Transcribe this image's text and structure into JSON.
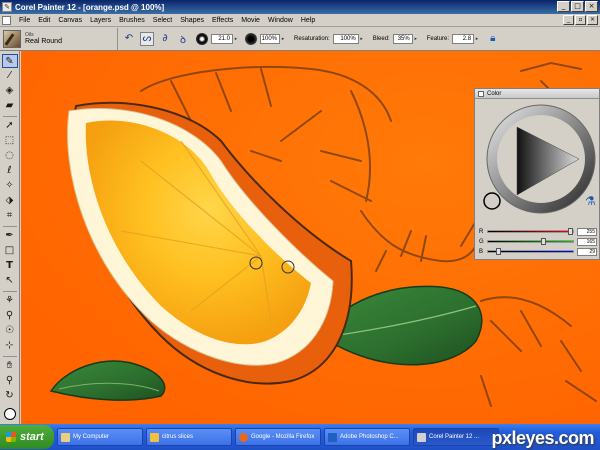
{
  "window": {
    "title": "Corel Painter 12 - [orange.psd @ 100%]",
    "controls": [
      "_",
      "□",
      "×"
    ]
  },
  "menubar": {
    "items": [
      "File",
      "Edit",
      "Canvas",
      "Layers",
      "Brushes",
      "Select",
      "Shapes",
      "Effects",
      "Movie",
      "Window",
      "Help"
    ],
    "mdi_controls": [
      "_",
      "▫",
      "×"
    ]
  },
  "propertybar": {
    "brush_category": "Oils",
    "brush_variant": "Real Round",
    "size": "21.0",
    "opacity": "100%",
    "resaturation_label": "Resaturation:",
    "resaturation": "100%",
    "bleed_label": "Bleed:",
    "bleed": "35%",
    "feature_label": "Feature:",
    "feature": "2.8"
  },
  "toolbox": {
    "tools": [
      "brush-tool",
      "dropper-tool",
      "paint-bucket-tool",
      "eraser-tool",
      "layer-adjuster-tool",
      "rectangular-selection-tool",
      "oval-selection-tool",
      "lasso-tool",
      "magic-wand-tool",
      "transform-tool",
      "crop-tool",
      "pen-tool",
      "rectangle-shape-tool",
      "text-tool",
      "shape-selection-tool",
      "cloner-tool",
      "rubber-stamp-tool",
      "dodge-tool",
      "mirror-tool",
      "grabber-tool",
      "magnifier-tool",
      "rotate-page-tool"
    ]
  },
  "color_panel": {
    "title": "Color",
    "r_label": "R",
    "g_label": "G",
    "b_label": "B",
    "r": 255,
    "g": 165,
    "b": 29,
    "main_color": "#ff6f00"
  },
  "taskbar": {
    "start_label": "start",
    "tasks": [
      {
        "label": "My Computer",
        "icon": "#e8d080"
      },
      {
        "label": "citrus slices",
        "icon": "#f0c040"
      },
      {
        "label": "Google - Mozilla Firefox",
        "icon": "#e86820"
      },
      {
        "label": "Adobe Photoshop C...",
        "icon": "#2060c0"
      },
      {
        "label": "Corel Painter 12 ...",
        "icon": "#d0d0d0"
      }
    ],
    "watermark": "pxleyes.com"
  }
}
